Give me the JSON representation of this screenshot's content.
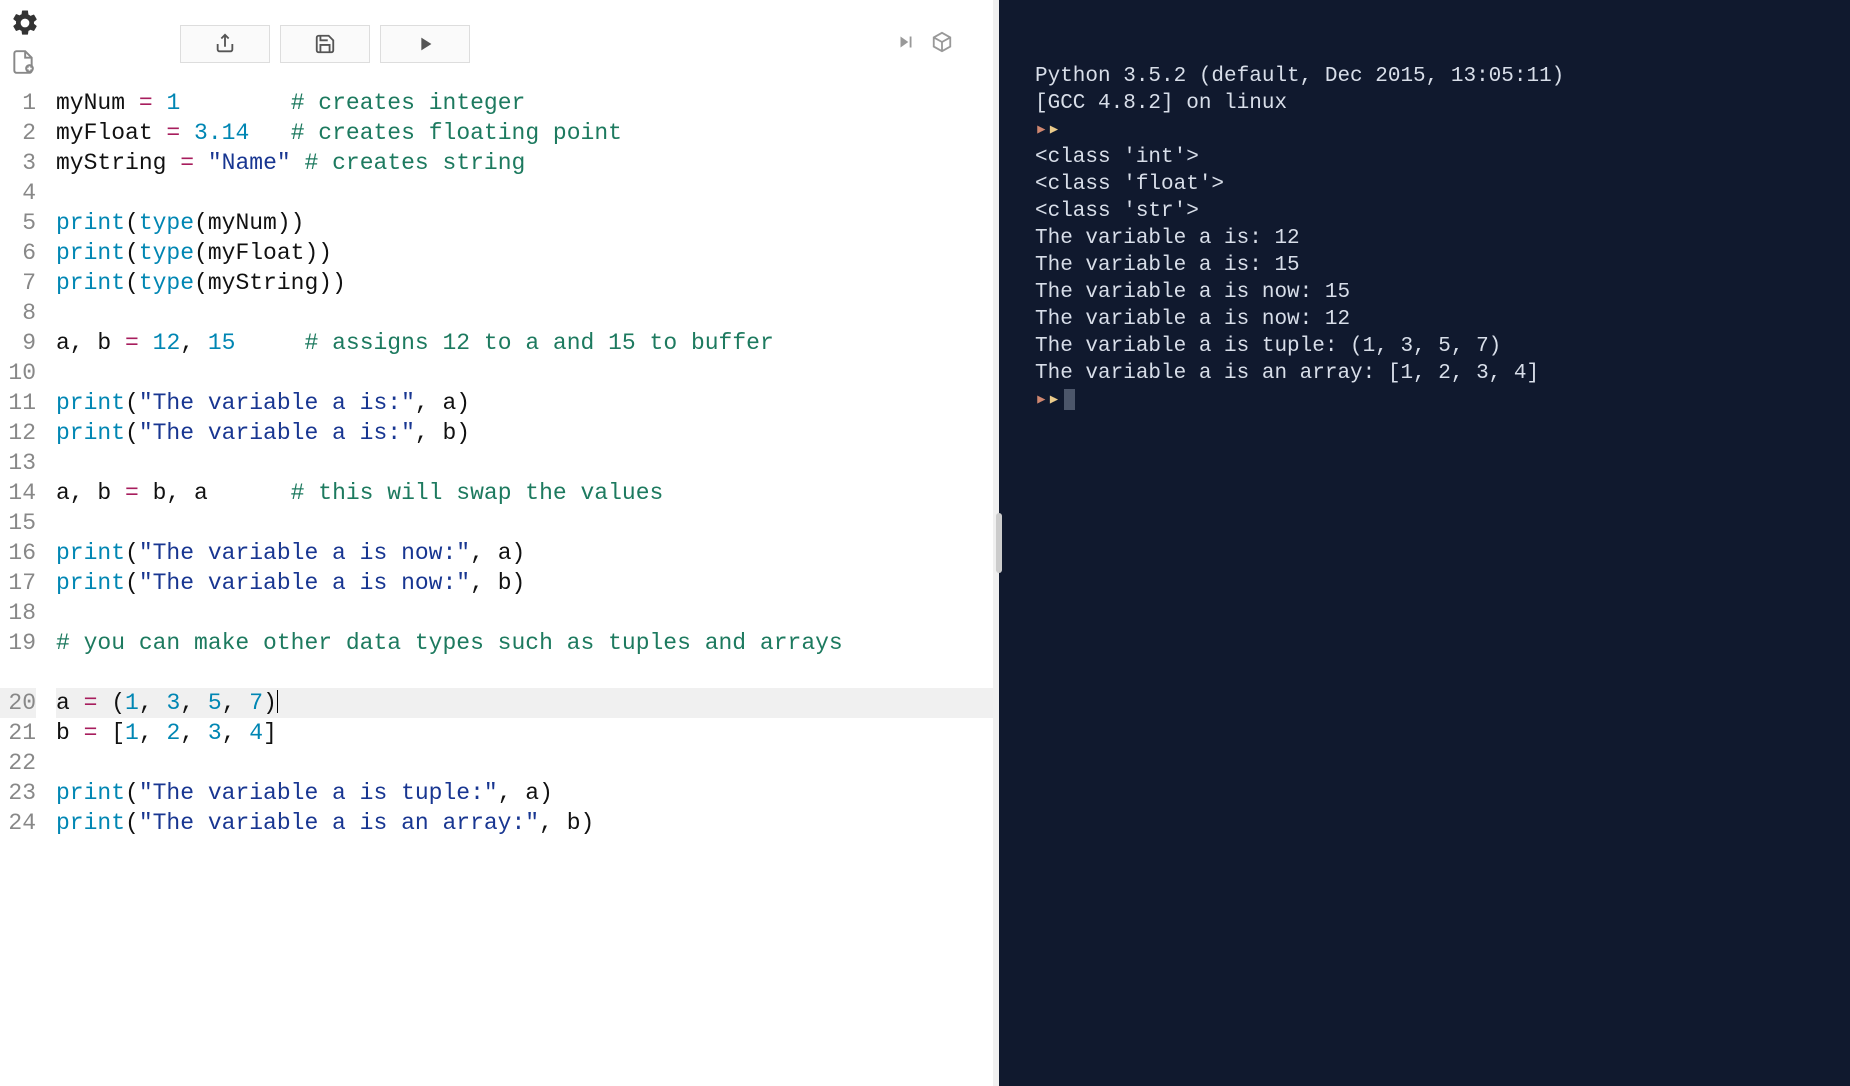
{
  "editor": {
    "lines": [
      {
        "n": 1,
        "tokens": [
          {
            "t": "myNum ",
            "c": "t-var"
          },
          {
            "t": "=",
            "c": "t-op"
          },
          {
            "t": " ",
            "c": ""
          },
          {
            "t": "1",
            "c": "t-num"
          },
          {
            "t": "        ",
            "c": ""
          },
          {
            "t": "# creates integer",
            "c": "t-com"
          }
        ]
      },
      {
        "n": 2,
        "tokens": [
          {
            "t": "myFloat ",
            "c": "t-var"
          },
          {
            "t": "=",
            "c": "t-op"
          },
          {
            "t": " ",
            "c": ""
          },
          {
            "t": "3.14",
            "c": "t-num"
          },
          {
            "t": "   ",
            "c": ""
          },
          {
            "t": "# creates floating point",
            "c": "t-com"
          }
        ]
      },
      {
        "n": 3,
        "tokens": [
          {
            "t": "myString ",
            "c": "t-var"
          },
          {
            "t": "=",
            "c": "t-op"
          },
          {
            "t": " ",
            "c": ""
          },
          {
            "t": "\"Name\"",
            "c": "t-str"
          },
          {
            "t": " ",
            "c": ""
          },
          {
            "t": "# creates string",
            "c": "t-com"
          }
        ]
      },
      {
        "n": 4,
        "tokens": []
      },
      {
        "n": 5,
        "tokens": [
          {
            "t": "print",
            "c": "t-fn"
          },
          {
            "t": "(",
            "c": "t-paren"
          },
          {
            "t": "type",
            "c": "t-fn"
          },
          {
            "t": "(myNum))",
            "c": "t-paren"
          }
        ]
      },
      {
        "n": 6,
        "tokens": [
          {
            "t": "print",
            "c": "t-fn"
          },
          {
            "t": "(",
            "c": "t-paren"
          },
          {
            "t": "type",
            "c": "t-fn"
          },
          {
            "t": "(myFloat))",
            "c": "t-paren"
          }
        ]
      },
      {
        "n": 7,
        "tokens": [
          {
            "t": "print",
            "c": "t-fn"
          },
          {
            "t": "(",
            "c": "t-paren"
          },
          {
            "t": "type",
            "c": "t-fn"
          },
          {
            "t": "(myString))",
            "c": "t-paren"
          }
        ]
      },
      {
        "n": 8,
        "tokens": []
      },
      {
        "n": 9,
        "tokens": [
          {
            "t": "a, b ",
            "c": "t-var"
          },
          {
            "t": "=",
            "c": "t-op"
          },
          {
            "t": " ",
            "c": ""
          },
          {
            "t": "12",
            "c": "t-num"
          },
          {
            "t": ", ",
            "c": "t-paren"
          },
          {
            "t": "15",
            "c": "t-num"
          },
          {
            "t": "     ",
            "c": ""
          },
          {
            "t": "# assigns 12 to a and 15 to buffer",
            "c": "t-com"
          }
        ]
      },
      {
        "n": 10,
        "tokens": []
      },
      {
        "n": 11,
        "tokens": [
          {
            "t": "print",
            "c": "t-fn"
          },
          {
            "t": "(",
            "c": "t-paren"
          },
          {
            "t": "\"The variable a is:\"",
            "c": "t-str"
          },
          {
            "t": ", a)",
            "c": "t-paren"
          }
        ]
      },
      {
        "n": 12,
        "tokens": [
          {
            "t": "print",
            "c": "t-fn"
          },
          {
            "t": "(",
            "c": "t-paren"
          },
          {
            "t": "\"The variable a is:\"",
            "c": "t-str"
          },
          {
            "t": ", b)",
            "c": "t-paren"
          }
        ]
      },
      {
        "n": 13,
        "tokens": []
      },
      {
        "n": 14,
        "tokens": [
          {
            "t": "a, b ",
            "c": "t-var"
          },
          {
            "t": "=",
            "c": "t-op"
          },
          {
            "t": " b, a      ",
            "c": "t-var"
          },
          {
            "t": "# this will swap the values",
            "c": "t-com"
          }
        ]
      },
      {
        "n": 15,
        "tokens": []
      },
      {
        "n": 16,
        "tokens": [
          {
            "t": "print",
            "c": "t-fn"
          },
          {
            "t": "(",
            "c": "t-paren"
          },
          {
            "t": "\"The variable a is now:\"",
            "c": "t-str"
          },
          {
            "t": ", a)",
            "c": "t-paren"
          }
        ]
      },
      {
        "n": 17,
        "tokens": [
          {
            "t": "print",
            "c": "t-fn"
          },
          {
            "t": "(",
            "c": "t-paren"
          },
          {
            "t": "\"The variable a is now:\"",
            "c": "t-str"
          },
          {
            "t": ", b)",
            "c": "t-paren"
          }
        ]
      },
      {
        "n": 18,
        "tokens": []
      },
      {
        "n": 19,
        "tokens": [
          {
            "t": "# you can make other data types such as tuples and arrays",
            "c": "t-com"
          }
        ],
        "wrap": true
      },
      {
        "n": 20,
        "tokens": [
          {
            "t": "a ",
            "c": "t-var"
          },
          {
            "t": "=",
            "c": "t-op"
          },
          {
            "t": " (",
            "c": "t-paren"
          },
          {
            "t": "1",
            "c": "t-num"
          },
          {
            "t": ", ",
            "c": "t-paren"
          },
          {
            "t": "3",
            "c": "t-num"
          },
          {
            "t": ", ",
            "c": "t-paren"
          },
          {
            "t": "5",
            "c": "t-num"
          },
          {
            "t": ", ",
            "c": "t-paren"
          },
          {
            "t": "7",
            "c": "t-num"
          },
          {
            "t": ")",
            "c": "t-paren"
          }
        ],
        "active": true,
        "cursor": true
      },
      {
        "n": 21,
        "tokens": [
          {
            "t": "b ",
            "c": "t-var"
          },
          {
            "t": "=",
            "c": "t-op"
          },
          {
            "t": " [",
            "c": "t-paren"
          },
          {
            "t": "1",
            "c": "t-num"
          },
          {
            "t": ", ",
            "c": "t-paren"
          },
          {
            "t": "2",
            "c": "t-num"
          },
          {
            "t": ", ",
            "c": "t-paren"
          },
          {
            "t": "3",
            "c": "t-num"
          },
          {
            "t": ", ",
            "c": "t-paren"
          },
          {
            "t": "4",
            "c": "t-num"
          },
          {
            "t": "]",
            "c": "t-paren"
          }
        ]
      },
      {
        "n": 22,
        "tokens": []
      },
      {
        "n": 23,
        "tokens": [
          {
            "t": "print",
            "c": "t-fn"
          },
          {
            "t": "(",
            "c": "t-paren"
          },
          {
            "t": "\"The variable a is tuple:\"",
            "c": "t-str"
          },
          {
            "t": ", a)",
            "c": "t-paren"
          }
        ]
      },
      {
        "n": 24,
        "tokens": [
          {
            "t": "print",
            "c": "t-fn"
          },
          {
            "t": "(",
            "c": "t-paren"
          },
          {
            "t": "\"The variable a is an array:\"",
            "c": "t-str"
          },
          {
            "t": ", b)",
            "c": "t-paren"
          }
        ]
      }
    ]
  },
  "terminal": {
    "header1": "Python 3.5.2 (default, Dec 2015, 13:05:11)",
    "header2": "[GCC 4.8.2] on linux",
    "output": [
      "<class 'int'>",
      "<class 'float'>",
      "<class 'str'>",
      "The variable a is: 12",
      "The variable a is: 15",
      "The variable a is now: 15",
      "The variable a is now: 12",
      "The variable a is tuple: (1, 3, 5, 7)",
      "The variable a is an array: [1, 2, 3, 4]"
    ]
  }
}
